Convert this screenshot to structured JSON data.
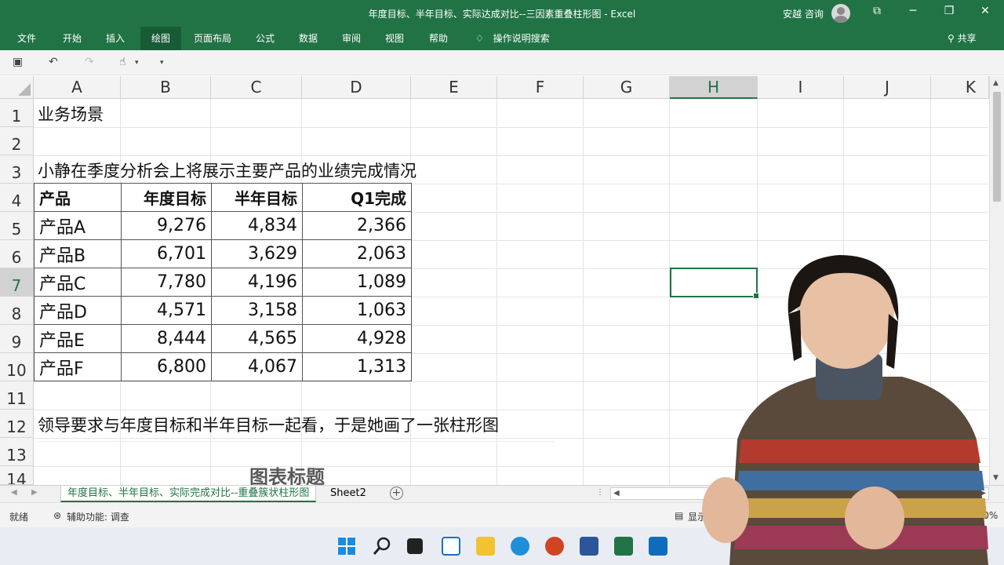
{
  "window": {
    "title": "年度目标、半年目标、实际达成对比--三因素重叠柱形图  -  Excel",
    "user_name": "安越 咨询",
    "controls": [
      "restore-ribbon",
      "minimize",
      "maximize",
      "close"
    ]
  },
  "ribbon": {
    "tabs": [
      {
        "label": "文件",
        "active": false
      },
      {
        "label": "开始",
        "active": false
      },
      {
        "label": "插入",
        "active": false
      },
      {
        "label": "绘图",
        "active": true
      },
      {
        "label": "页面布局",
        "active": false
      },
      {
        "label": "公式",
        "active": false
      },
      {
        "label": "数据",
        "active": false
      },
      {
        "label": "审阅",
        "active": false
      },
      {
        "label": "视图",
        "active": false
      },
      {
        "label": "帮助",
        "active": false
      }
    ],
    "tell_me": "操作说明搜索",
    "share": "共享"
  },
  "columns": [
    "A",
    "B",
    "C",
    "D",
    "E",
    "F",
    "G",
    "H",
    "I",
    "J",
    "K"
  ],
  "selected_column": "H",
  "rows": [
    "1",
    "2",
    "3",
    "4",
    "5",
    "6",
    "7",
    "8",
    "9",
    "10",
    "11",
    "12",
    "13",
    "14"
  ],
  "selected_row": "7",
  "sheet": {
    "a1": "业务场景",
    "a3": "小静在季度分析会上将展示主要产品的业绩完成情况",
    "a12": "领导要求与年度目标和半年目标一起看，于是她画了一张柱形图",
    "chart_title": "图表标题"
  },
  "table": {
    "headers": [
      "产品",
      "年度目标",
      "半年目标",
      "Q1完成"
    ],
    "rows": [
      [
        "产品A",
        "9,276",
        "4,834",
        "2,366"
      ],
      [
        "产品B",
        "6,701",
        "3,629",
        "2,063"
      ],
      [
        "产品C",
        "7,780",
        "4,196",
        "1,089"
      ],
      [
        "产品D",
        "4,571",
        "3,158",
        "1,063"
      ],
      [
        "产品E",
        "8,444",
        "4,565",
        "4,928"
      ],
      [
        "产品F",
        "6,800",
        "4,067",
        "1,313"
      ]
    ]
  },
  "sheet_tabs": [
    {
      "label": "年度目标、半年目标、实际完成对比--重叠簇状柱形图",
      "active": true
    },
    {
      "label": "Sheet2",
      "active": false
    }
  ],
  "status": {
    "ready": "就绪",
    "accessibility": "辅助功能: 调查",
    "display": "显示",
    "zoom": "160%"
  },
  "colors": {
    "excel_green": "#217346",
    "ribbon_active": "#185c37"
  }
}
